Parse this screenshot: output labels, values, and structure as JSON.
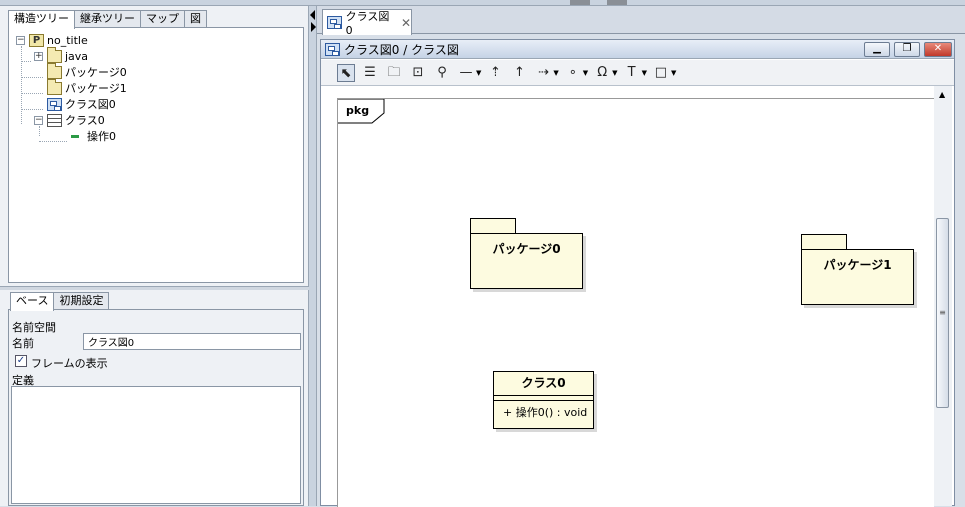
{
  "structure_tabs": [
    {
      "label": "構造ツリー"
    },
    {
      "label": "継承ツリー"
    },
    {
      "label": "マップ"
    },
    {
      "label": "図"
    }
  ],
  "tree": {
    "root": "no_title",
    "items": [
      {
        "label": "java"
      },
      {
        "label": "パッケージ0"
      },
      {
        "label": "パッケージ1"
      },
      {
        "label": "クラス図0"
      },
      {
        "label": "クラス0"
      },
      {
        "label": "操作0"
      }
    ],
    "expand_collapse_signs": {
      "plus": "+",
      "minus": "−"
    }
  },
  "property_tabs": [
    {
      "label": "ベース"
    },
    {
      "label": "初期設定"
    }
  ],
  "properties": {
    "namespace_label": "名前空間",
    "name_label": "名前",
    "name_value": "クラス図0",
    "frame_checkbox_label": "フレームの表示",
    "frame_checked": true,
    "checkmark": "✓",
    "definition_label": "定義"
  },
  "document_tab": {
    "label": "クラス図0",
    "close_glyph": "✕"
  },
  "diagram_window": {
    "title": "クラス図0 / クラス図",
    "minimize_glyph": "▁",
    "restore_glyph": "❐",
    "close_glyph": "✕"
  },
  "toolbar": {
    "tools": [
      "select",
      "class",
      "package",
      "subsystem",
      "pin",
      "association",
      "generalization",
      "dependency",
      "realization",
      "comment",
      "fill-color",
      "text",
      "rectangle"
    ],
    "glyphs": {
      "select": "⬉",
      "class": "☰",
      "package": "🗀",
      "subsystem": "⊡",
      "pin": "⚲",
      "association": "—",
      "generalization": "⇡",
      "dependency": "↑",
      "realization": "⇢",
      "comment": "∘",
      "fill-color": "Ω",
      "text": "T",
      "rectangle": "□",
      "dropdown": "▼"
    }
  },
  "diagram": {
    "frame_label": "pkg",
    "packages": [
      {
        "name": "パッケージ0"
      },
      {
        "name": "パッケージ1"
      }
    ],
    "classes": [
      {
        "name": "クラス0",
        "operations": [
          "+ 操作0() : void"
        ]
      }
    ]
  },
  "scrollbar": {
    "up_glyph": "▲",
    "grip_glyph": "≡"
  },
  "colors": {
    "note_fill": "#fdfbe0",
    "op_icon": "#2b9a45",
    "close_button": "#c0392b"
  }
}
